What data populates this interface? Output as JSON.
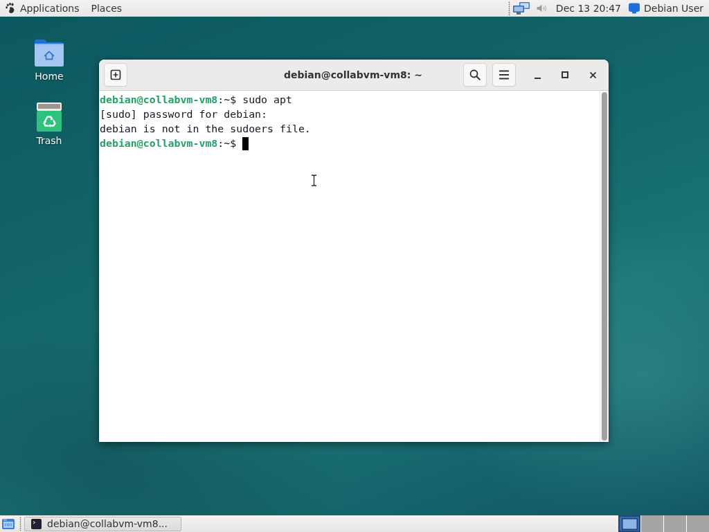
{
  "top_panel": {
    "menus": [
      {
        "label": "Applications"
      },
      {
        "label": "Places"
      }
    ],
    "clock": "Dec 13 20:47",
    "user": "Debian User"
  },
  "desktop_icons": [
    {
      "kind": "home",
      "label": "Home"
    },
    {
      "kind": "trash",
      "label": "Trash"
    }
  ],
  "terminal": {
    "title": "debian@collabvm-vm8: ~",
    "lines": [
      {
        "kind": "prompt",
        "user_host": "debian@collabvm-vm8",
        "prompt": ":~$",
        "command": "sudo apt",
        "cursor": false
      },
      {
        "kind": "output",
        "text": "[sudo] password for debian:",
        "cursor": false
      },
      {
        "kind": "output",
        "text": "debian is not in the sudoers file.",
        "cursor": false
      },
      {
        "kind": "prompt",
        "user_host": "debian@collabvm-vm8",
        "prompt": ":~$",
        "cursor": true
      }
    ]
  },
  "bottom_panel": {
    "tasks": [
      {
        "label": "debian@collabvm-vm8..."
      }
    ],
    "workspaces": [
      {
        "selected": true,
        "has_window": true
      },
      {
        "selected": false,
        "has_window": false
      },
      {
        "selected": false,
        "has_window": false
      },
      {
        "selected": false,
        "has_window": false
      }
    ]
  }
}
